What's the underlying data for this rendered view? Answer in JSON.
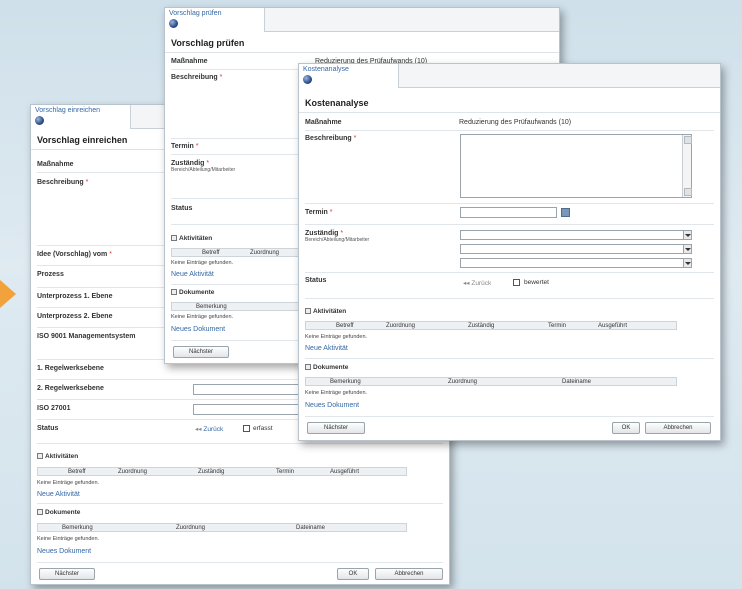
{
  "win1": {
    "tab": "Vorschlag einreichen",
    "title": "Vorschlag einreichen",
    "labels": {
      "massnahme": "Maßnahme",
      "beschreibung": "Beschreibung",
      "idee": "Idee (Vorschlag) vom",
      "prozess": "Prozess",
      "unterprozess1": "Unterprozess 1. Ebene",
      "unterprozess2": "Unterprozess 2. Ebene",
      "iso9001": "ISO 9001 Managementsystem",
      "regel1": "1. Regelwerksebene",
      "regel2": "2. Regelwerksebene",
      "iso27001": "ISO 27001",
      "status": "Status"
    },
    "status_back": "Zurück",
    "status_checkbox": "erfasst",
    "aktivitaeten": {
      "title": "Aktivitäten",
      "columns": [
        "Betreff",
        "Zuordnung",
        "Zuständig",
        "Termin",
        "Ausgeführt"
      ],
      "empty": "Keine Einträge gefunden.",
      "new_link": "Neue Aktivität"
    },
    "dokumente": {
      "title": "Dokumente",
      "columns": [
        "Bemerkung",
        "Zuordnung",
        "Dateiname"
      ],
      "empty": "Keine Einträge gefunden.",
      "new_link": "Neues Dokument"
    },
    "buttons": {
      "next": "Nächster",
      "ok": "OK",
      "cancel": "Abbrechen"
    }
  },
  "win2": {
    "tab": "Vorschlag prüfen",
    "title": "Vorschlag prüfen",
    "labels": {
      "massnahme": "Maßnahme",
      "beschreibung": "Beschreibung",
      "termin": "Termin",
      "zustaendig": "Zuständig",
      "zustaendig_sub": "Bereich/Abteilung/Mitarbeiter",
      "status": "Status"
    },
    "massnahme_value": "Reduzierung des Prüfaufwands (10)",
    "aktivitaeten": {
      "title": "Aktivitäten",
      "columns": [
        "Betreff",
        "Zuordnung"
      ],
      "empty": "Keine Einträge gefunden.",
      "new_link": "Neue Aktivität"
    },
    "dokumente": {
      "title": "Dokumente",
      "columns": [
        "Bemerkung"
      ],
      "empty": "Keine Einträge gefunden.",
      "new_link": "Neues Dokument"
    },
    "buttons": {
      "next": "Nächster"
    }
  },
  "win3": {
    "tab": "Kostenanalyse",
    "title": "Kostenanalyse",
    "labels": {
      "massnahme": "Maßnahme",
      "beschreibung": "Beschreibung",
      "termin": "Termin",
      "zustaendig": "Zuständig",
      "zustaendig_sub": "Bereich/Abteilung/Mitarbeiter",
      "status": "Status"
    },
    "massnahme_value": "Reduzierung des Prüfaufwands (10)",
    "status_back": "Zurück",
    "status_checkbox": "bewertet",
    "aktivitaeten": {
      "title": "Aktivitäten",
      "columns": [
        "Betreff",
        "Zuordnung",
        "Zuständig",
        "Termin",
        "Ausgeführt"
      ],
      "empty": "Keine Einträge gefunden.",
      "new_link": "Neue Aktivität"
    },
    "dokumente": {
      "title": "Dokumente",
      "columns": [
        "Bemerkung",
        "Zuordnung",
        "Dateiname"
      ],
      "empty": "Keine Einträge gefunden.",
      "new_link": "Neues Dokument"
    },
    "buttons": {
      "next": "Nächster",
      "ok": "OK",
      "cancel": "Abbrechen"
    }
  },
  "required_marker": "*",
  "colors": {
    "accent_arrow": "#f2a23a",
    "link": "#3468a4",
    "background": "#d7e6ee"
  }
}
